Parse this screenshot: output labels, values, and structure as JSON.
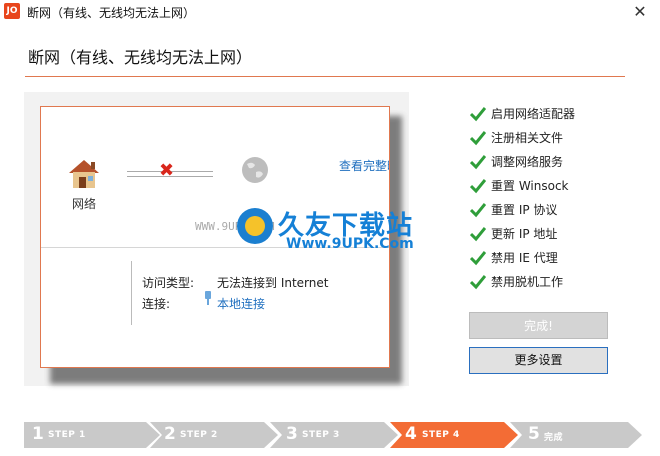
{
  "window": {
    "title": "断网（有线、无线均无法上网）",
    "app_icon_text": "JO",
    "close_glyph": "✕"
  },
  "header": {
    "title": "断网（有线、无线均无法上网）"
  },
  "diagram": {
    "network_label": "网络",
    "view_link": "查看完整映射",
    "access_type_label": "访问类型:",
    "access_type_value": "无法连接到 Internet",
    "connection_label": "连接:",
    "connection_value": "本地连接"
  },
  "watermark": {
    "brand": "久友下载站",
    "url": "Www.9UPK.Com",
    "left_text": "WWW.9UPK.COM"
  },
  "checklist": [
    {
      "label": "启用网络适配器",
      "checked": true
    },
    {
      "label": "注册相关文件",
      "checked": true
    },
    {
      "label": "调整网络服务",
      "checked": true
    },
    {
      "label": "重置 Winsock",
      "checked": true
    },
    {
      "label": "重置 IP 协议",
      "checked": true
    },
    {
      "label": "更新 IP 地址",
      "checked": true
    },
    {
      "label": "禁用 IE 代理",
      "checked": true
    },
    {
      "label": "禁用脱机工作",
      "checked": true
    }
  ],
  "buttons": {
    "done": "完成!",
    "more": "更多设置"
  },
  "steps": [
    {
      "num": "1",
      "label": "STEP 1",
      "state": "done"
    },
    {
      "num": "2",
      "label": "STEP 2",
      "state": "done"
    },
    {
      "num": "3",
      "label": "STEP 3",
      "state": "done"
    },
    {
      "num": "4",
      "label": "STEP 4",
      "state": "active"
    },
    {
      "num": "5",
      "label": "完成",
      "state": "pending"
    }
  ],
  "colors": {
    "accent": "#f36c35",
    "step_inactive": "#c9c9c9",
    "link": "#1f6fbf",
    "check": "#2f9e3a"
  }
}
